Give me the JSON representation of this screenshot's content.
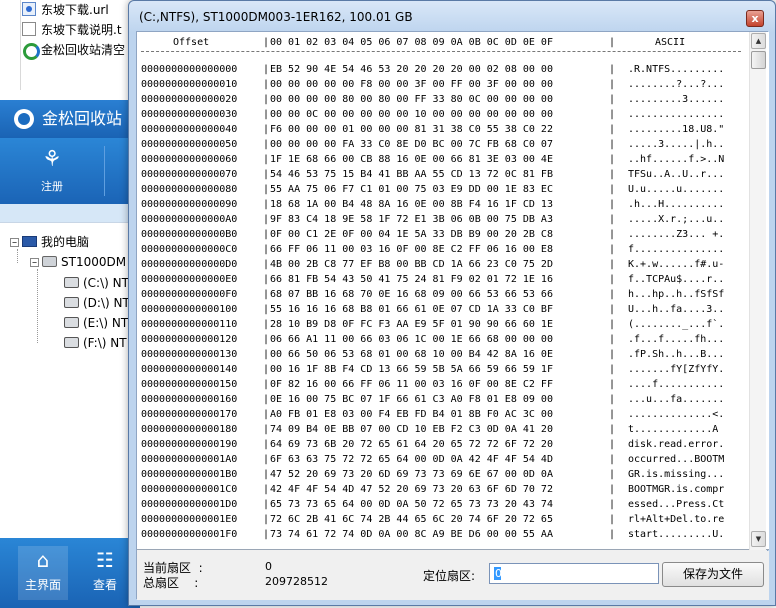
{
  "explorer": {
    "files": [
      {
        "name": "东坡下载.url",
        "type": "url"
      },
      {
        "name": "东坡下载说明.t",
        "type": "txt"
      },
      {
        "name": "金松回收站清空",
        "type": "exe"
      }
    ]
  },
  "app": {
    "title": "金松回收站",
    "toolbar_register": "注册",
    "tree": {
      "root": "我的电脑",
      "disk": "ST1000DM",
      "drives": [
        "(C:\\) NT",
        "(D:\\) NT",
        "(E:\\) NT",
        "(F:\\) NT"
      ]
    },
    "nav": {
      "home": "主界面",
      "view": "查看"
    }
  },
  "dialog": {
    "title": "(C:,NTFS), ST1000DM003-1ER162, 100.01 GB",
    "close_glyph": "x",
    "hex_header": {
      "offset": "Offset",
      "sep": "|",
      "columns": "00 01 02 03 04 05 06 07 08 09 0A 0B 0C 0D 0E 0F",
      "ascii": "ASCII"
    },
    "rows": [
      {
        "off": "0000000000000000",
        "hex": "EB 52 90 4E 54 46 53 20 20 20 20 00 02 08 00 00",
        "asc": ".R.NTFS........."
      },
      {
        "off": "0000000000000010",
        "hex": "00 00 00 00 00 F8 00 00 3F 00 FF 00 3F 00 00 00",
        "asc": "........?...?..."
      },
      {
        "off": "0000000000000020",
        "hex": "00 00 00 00 80 00 80 00 FF 33 80 0C 00 00 00 00",
        "asc": ".........3......"
      },
      {
        "off": "0000000000000030",
        "hex": "00 00 0C 00 00 00 00 00 10 00 00 00 00 00 00 00",
        "asc": "................"
      },
      {
        "off": "0000000000000040",
        "hex": "F6 00 00 00 01 00 00 00 81 31 38 C0 55 38 C0 22",
        "asc": ".........18.U8.\""
      },
      {
        "off": "0000000000000050",
        "hex": "00 00 00 00 FA 33 C0 8E D0 BC 00 7C FB 68 C0 07",
        "asc": ".....3.....|.h.."
      },
      {
        "off": "0000000000000060",
        "hex": "1F 1E 68 66 00 CB 88 16 0E 00 66 81 3E 03 00 4E",
        "asc": "..hf......f.>..N"
      },
      {
        "off": "0000000000000070",
        "hex": "54 46 53 75 15 B4 41 BB AA 55 CD 13 72 0C 81 FB",
        "asc": "TFSu..A..U..r..."
      },
      {
        "off": "0000000000000080",
        "hex": "55 AA 75 06 F7 C1 01 00 75 03 E9 DD 00 1E 83 EC",
        "asc": "U.u.....u......."
      },
      {
        "off": "0000000000000090",
        "hex": "18 68 1A 00 B4 48 8A 16 0E 00 8B F4 16 1F CD 13",
        "asc": ".h...H.........."
      },
      {
        "off": "00000000000000A0",
        "hex": "9F 83 C4 18 9E 58 1F 72 E1 3B 06 0B 00 75 DB A3",
        "asc": ".....X.r.;...u.."
      },
      {
        "off": "00000000000000B0",
        "hex": "0F 00 C1 2E 0F 00 04 1E 5A 33 DB B9 00 20 2B C8",
        "asc": "........Z3... +."
      },
      {
        "off": "00000000000000C0",
        "hex": "66 FF 06 11 00 03 16 0F 00 8E C2 FF 06 16 00 E8",
        "asc": "f..............."
      },
      {
        "off": "00000000000000D0",
        "hex": "4B 00 2B C8 77 EF B8 00 BB CD 1A 66 23 C0 75 2D",
        "asc": "K.+.w......f#.u-"
      },
      {
        "off": "00000000000000E0",
        "hex": "66 81 FB 54 43 50 41 75 24 81 F9 02 01 72 1E 16",
        "asc": "f..TCPAu$....r.."
      },
      {
        "off": "00000000000000F0",
        "hex": "68 07 BB 16 68 70 0E 16 68 09 00 66 53 66 53 66",
        "asc": "h...hp..h..fSfSf"
      },
      {
        "off": "0000000000000100",
        "hex": "55 16 16 16 68 B8 01 66 61 0E 07 CD 1A 33 C0 BF",
        "asc": "U...h..fa....3.."
      },
      {
        "off": "0000000000000110",
        "hex": "28 10 B9 D8 0F FC F3 AA E9 5F 01 90 90 66 60 1E",
        "asc": "(........_...f`."
      },
      {
        "off": "0000000000000120",
        "hex": "06 66 A1 11 00 66 03 06 1C 00 1E 66 68 00 00 00",
        "asc": ".f...f.....fh..."
      },
      {
        "off": "0000000000000130",
        "hex": "00 66 50 06 53 68 01 00 68 10 00 B4 42 8A 16 0E",
        "asc": ".fP.Sh..h...B..."
      },
      {
        "off": "0000000000000140",
        "hex": "00 16 1F 8B F4 CD 13 66 59 5B 5A 66 59 66 59 1F",
        "asc": ".......fY[ZfYfY."
      },
      {
        "off": "0000000000000150",
        "hex": "0F 82 16 00 66 FF 06 11 00 03 16 0F 00 8E C2 FF",
        "asc": "....f..........."
      },
      {
        "off": "0000000000000160",
        "hex": "0E 16 00 75 BC 07 1F 66 61 C3 A0 F8 01 E8 09 00",
        "asc": "...u...fa......."
      },
      {
        "off": "0000000000000170",
        "hex": "A0 FB 01 E8 03 00 F4 EB FD B4 01 8B F0 AC 3C 00",
        "asc": "..............<."
      },
      {
        "off": "0000000000000180",
        "hex": "74 09 B4 0E BB 07 00 CD 10 EB F2 C3 0D 0A 41 20",
        "asc": "t.............A "
      },
      {
        "off": "0000000000000190",
        "hex": "64 69 73 6B 20 72 65 61 64 20 65 72 72 6F 72 20",
        "asc": "disk.read.error."
      },
      {
        "off": "00000000000001A0",
        "hex": "6F 63 63 75 72 72 65 64 00 0D 0A 42 4F 4F 54 4D",
        "asc": "occurred...BOOTM"
      },
      {
        "off": "00000000000001B0",
        "hex": "47 52 20 69 73 20 6D 69 73 73 69 6E 67 00 0D 0A",
        "asc": "GR.is.missing..."
      },
      {
        "off": "00000000000001C0",
        "hex": "42 4F 4F 54 4D 47 52 20 69 73 20 63 6F 6D 70 72",
        "asc": "BOOTMGR.is.compr"
      },
      {
        "off": "00000000000001D0",
        "hex": "65 73 73 65 64 00 0D 0A 50 72 65 73 73 20 43 74",
        "asc": "essed...Press.Ct"
      },
      {
        "off": "00000000000001E0",
        "hex": "72 6C 2B 41 6C 74 2B 44 65 6C 20 74 6F 20 72 65",
        "asc": "rl+Alt+Del.to.re"
      },
      {
        "off": "00000000000001F0",
        "hex": "73 74 61 72 74 0D 0A 00 8C A9 BE D6 00 00 55 AA",
        "asc": "start.........U."
      }
    ],
    "footer": {
      "current_sector_label": "当前扇区  :",
      "current_sector_value": "0",
      "total_sector_label": "总扇区    :",
      "total_sector_value": "209728512",
      "goto_label": "定位扇区:",
      "goto_value": "0",
      "save_button": "保存为文件"
    }
  }
}
